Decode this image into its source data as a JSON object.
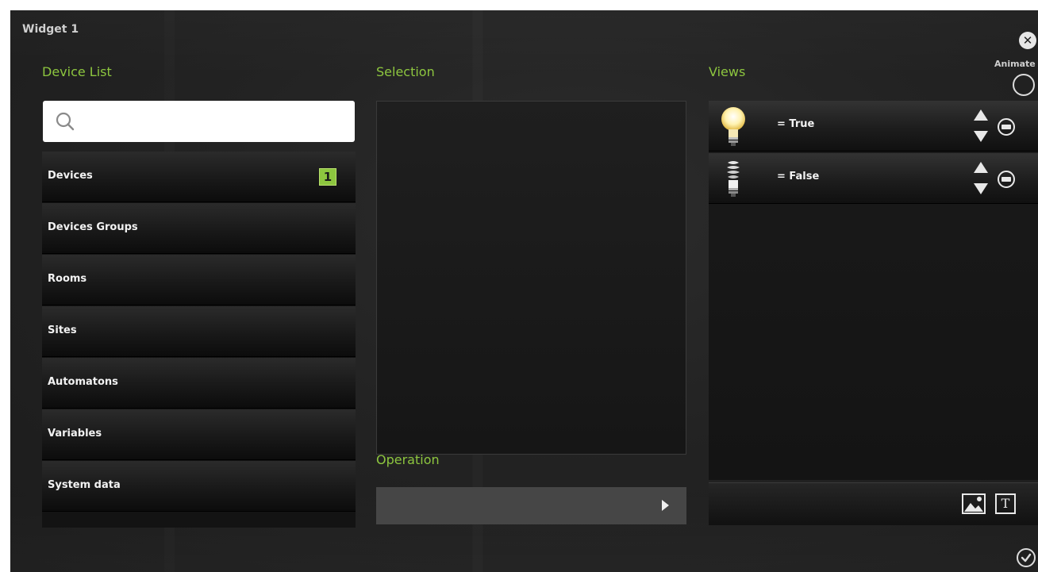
{
  "window": {
    "title": "Widget 1"
  },
  "header": {
    "animate_label": "Animate"
  },
  "device_list": {
    "heading": "Device List",
    "search": {
      "value": "",
      "placeholder": ""
    },
    "categories": [
      {
        "label": "Devices",
        "badge": "1"
      },
      {
        "label": "Devices Groups"
      },
      {
        "label": "Rooms"
      },
      {
        "label": "Sites"
      },
      {
        "label": "Automatons"
      },
      {
        "label": "Variables"
      },
      {
        "label": "System data"
      }
    ]
  },
  "selection": {
    "heading": "Selection"
  },
  "operation": {
    "heading": "Operation",
    "value": ""
  },
  "views": {
    "heading": "Views",
    "items": [
      {
        "label": "= True",
        "icon": "bulb-on-icon"
      },
      {
        "label": "= False",
        "icon": "bulb-off-icon"
      }
    ],
    "toolbar": {
      "image_icon": "image-icon",
      "text_icon": "text-icon",
      "text_glyph": "T"
    }
  },
  "colors": {
    "accent": "#8dc63f",
    "background": "#232323",
    "operation_bar": "#464646"
  }
}
